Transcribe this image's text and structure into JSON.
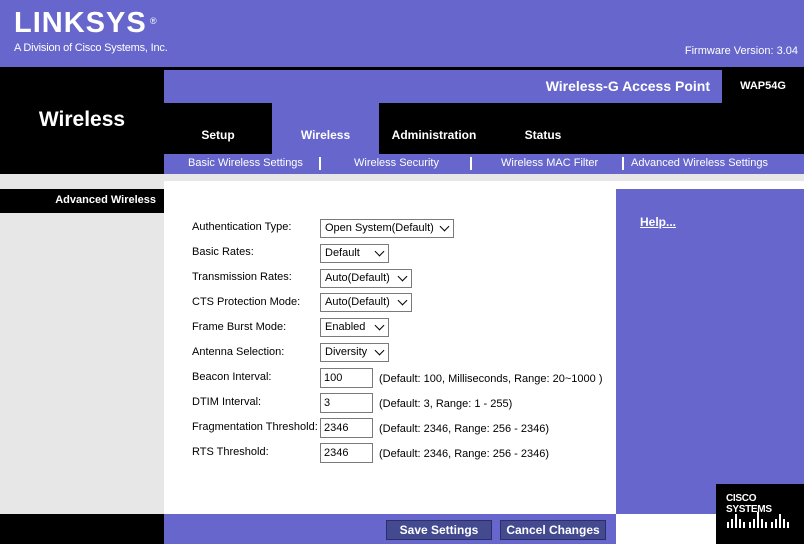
{
  "header": {
    "logo": "LINKSYS",
    "logo_reg": "®",
    "tagline": "A Division of Cisco Systems, Inc.",
    "firmware": "Firmware Version: 3.04",
    "product_name": "Wireless-G Access Point",
    "model": "WAP54G",
    "section_title": "Wireless"
  },
  "tabs": [
    {
      "label": "Setup"
    },
    {
      "label": "Wireless"
    },
    {
      "label": "Administration"
    },
    {
      "label": "Status"
    }
  ],
  "subtabs": [
    {
      "label": "Basic Wireless Settings"
    },
    {
      "label": "Wireless Security"
    },
    {
      "label": "Wireless MAC Filter"
    },
    {
      "label": "Advanced Wireless Settings"
    }
  ],
  "left_label": "Advanced Wireless",
  "form": {
    "auth_type": {
      "label": "Authentication Type:",
      "value": "Open System(Default)"
    },
    "basic_rates": {
      "label": "Basic Rates:",
      "value": "Default"
    },
    "tx_rates": {
      "label": "Transmission Rates:",
      "value": "Auto(Default)"
    },
    "cts": {
      "label": "CTS Protection Mode:",
      "value": "Auto(Default)"
    },
    "frame_burst": {
      "label": "Frame Burst Mode:",
      "value": "Enabled"
    },
    "antenna": {
      "label": "Antenna Selection:",
      "value": "Diversity"
    },
    "beacon": {
      "label": "Beacon Interval:",
      "value": "100",
      "hint": "(Default: 100, Milliseconds, Range: 20~1000 )"
    },
    "dtim": {
      "label": "DTIM Interval:",
      "value": "3",
      "hint": "(Default: 3, Range: 1 - 255)"
    },
    "frag": {
      "label": "Fragmentation Threshold:",
      "value": "2346",
      "hint": "(Default: 2346, Range: 256 - 2346)"
    },
    "rts": {
      "label": "RTS Threshold:",
      "value": "2346",
      "hint": "(Default: 2346, Range: 256 - 2346)"
    }
  },
  "help": {
    "label": "Help..."
  },
  "buttons": {
    "save": "Save Settings",
    "cancel": "Cancel Changes"
  },
  "cisco": {
    "text": "CISCO SYSTEMS"
  },
  "colors": {
    "accent": "#6666cc",
    "black": "#000000",
    "panel_gray": "#e7e7e7",
    "button": "#434a8f"
  },
  "icons": [
    "chevron-down-icon",
    "cisco-bars-icon"
  ]
}
